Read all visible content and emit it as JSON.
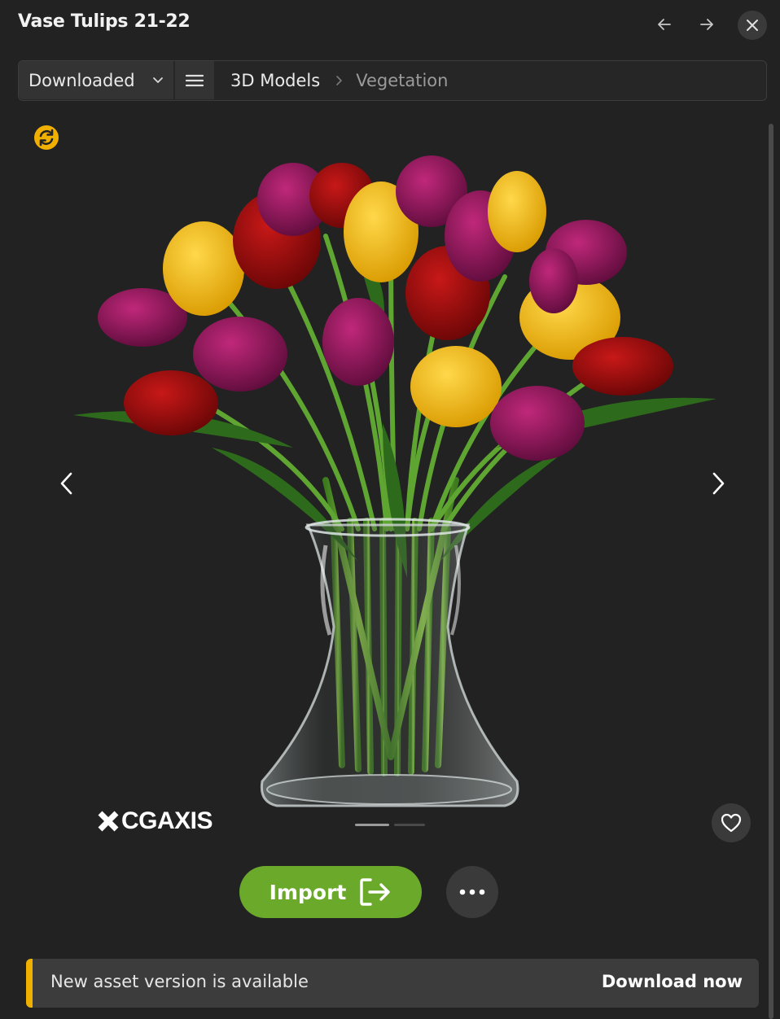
{
  "window": {
    "title": "Vase Tulips 21-22"
  },
  "icons": {
    "back": "arrow-left-icon",
    "forward": "arrow-right-icon",
    "close": "close-icon",
    "dropdown": "chevron-down-icon",
    "menu": "hamburger-menu-icon",
    "breadcrumb_separator": "chevron-right-icon",
    "sync": "sync-icon",
    "prev": "chevron-left-icon",
    "next": "chevron-right-icon",
    "favorite": "heart-icon",
    "import": "import-icon",
    "more": "more-dots-icon"
  },
  "toolbar": {
    "filter_value": "Downloaded",
    "breadcrumb": [
      "3D Models",
      "Vegetation"
    ]
  },
  "preview": {
    "brand": "CGAXIS",
    "slide_indicators": 2,
    "active_slide": 1
  },
  "actions": {
    "import_label": "Import"
  },
  "notice": {
    "message": "New asset version is available",
    "action_label": "Download now"
  },
  "colors": {
    "background": "#222222",
    "accent_green": "#6aa92a",
    "accent_yellow": "#f0b000",
    "panel": "#3a3a3a"
  }
}
